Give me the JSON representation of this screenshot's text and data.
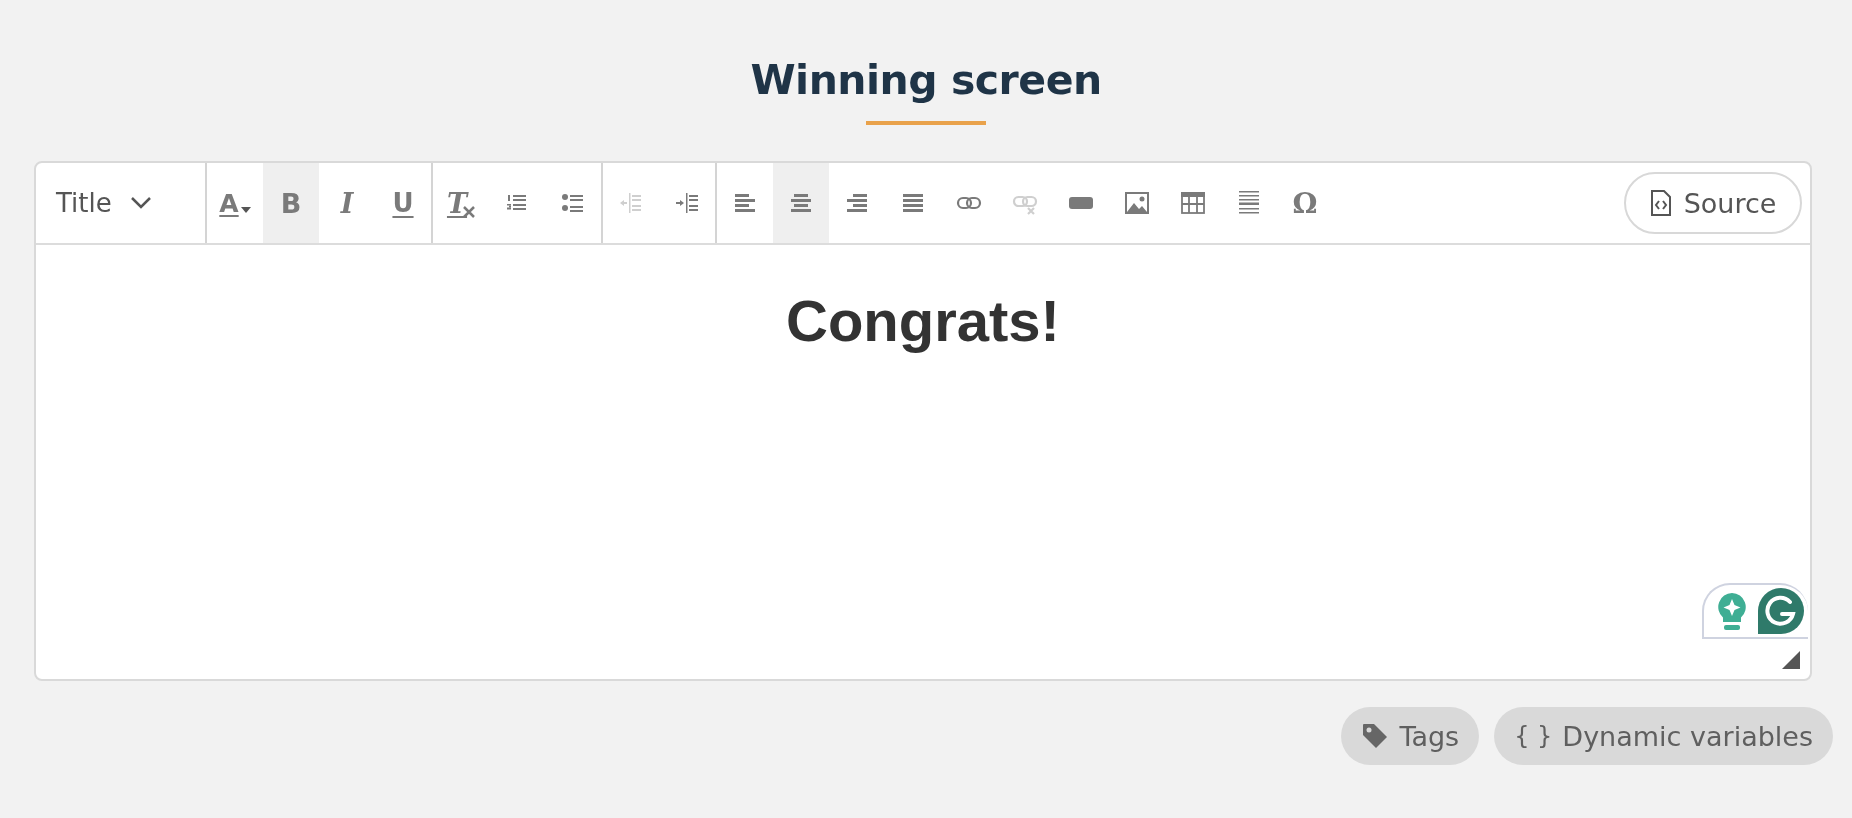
{
  "page_title": "Winning screen",
  "editor": {
    "toolbar": {
      "format_dropdown": {
        "label": "Title"
      },
      "groups": [
        {
          "buttons": [
            {
              "kind": "text-color",
              "glyph": "A",
              "selected": false,
              "disabled": false
            },
            {
              "kind": "bold",
              "glyph": "B",
              "selected": true,
              "disabled": false
            },
            {
              "kind": "italic",
              "glyph": "I",
              "selected": false,
              "disabled": false
            },
            {
              "kind": "underline",
              "glyph": "U",
              "selected": false,
              "disabled": false
            }
          ]
        },
        {
          "buttons": [
            {
              "kind": "remove-format",
              "glyph": "T",
              "selected": false,
              "disabled": false
            },
            {
              "kind": "numbered-list",
              "selected": false,
              "disabled": false
            },
            {
              "kind": "bulleted-list",
              "selected": false,
              "disabled": false
            }
          ]
        },
        {
          "buttons": [
            {
              "kind": "outdent",
              "selected": false,
              "disabled": true
            },
            {
              "kind": "indent",
              "selected": false,
              "disabled": false
            }
          ]
        },
        {
          "buttons": [
            {
              "kind": "align-left",
              "selected": false,
              "disabled": false
            },
            {
              "kind": "align-center",
              "selected": true,
              "disabled": false
            },
            {
              "kind": "align-right",
              "selected": false,
              "disabled": false
            },
            {
              "kind": "justify",
              "selected": false,
              "disabled": false
            },
            {
              "kind": "link",
              "selected": false,
              "disabled": false
            },
            {
              "kind": "unlink",
              "selected": false,
              "disabled": true
            },
            {
              "kind": "button",
              "selected": false,
              "disabled": false
            },
            {
              "kind": "image",
              "selected": false,
              "disabled": false
            },
            {
              "kind": "table",
              "selected": false,
              "disabled": false
            },
            {
              "kind": "horizontal-line",
              "selected": false,
              "disabled": false
            },
            {
              "kind": "special-char",
              "glyph": "Ω",
              "selected": false,
              "disabled": false
            }
          ]
        }
      ],
      "source_button": {
        "label": "Source"
      }
    },
    "content": {
      "heading": "Congrats!"
    }
  },
  "footer_buttons": [
    {
      "kind": "tags",
      "label": "Tags"
    },
    {
      "kind": "variables",
      "icon": "{ }",
      "label": "Dynamic variables"
    }
  ]
}
